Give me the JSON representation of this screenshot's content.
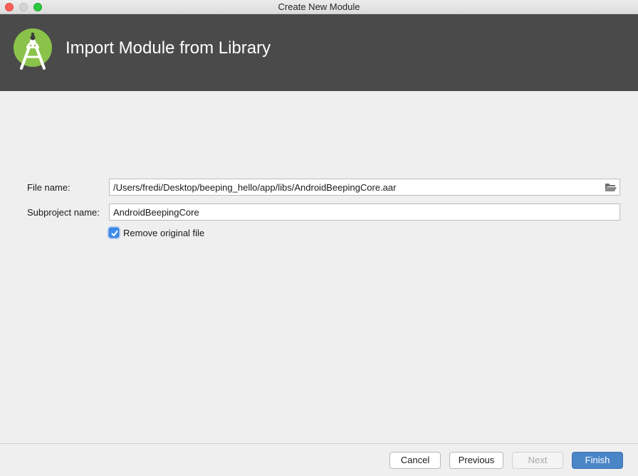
{
  "window": {
    "title": "Create New Module"
  },
  "banner": {
    "title": "Import Module from Library",
    "logo_icon": "android-studio-logo"
  },
  "form": {
    "file_name_label": "File name:",
    "file_name_value": "/Users/fredi/Desktop/beeping_hello/app/libs/AndroidBeepingCore.aar",
    "subproject_label": "Subproject name:",
    "subproject_value": "AndroidBeepingCore",
    "remove_original_label": "Remove original file",
    "remove_original_checked": true
  },
  "buttons": {
    "cancel": "Cancel",
    "previous": "Previous",
    "next": "Next",
    "finish": "Finish"
  },
  "colors": {
    "banner_bg": "#4a4a4a",
    "accent": "#4a86c7",
    "logo_green": "#8bc34a"
  }
}
